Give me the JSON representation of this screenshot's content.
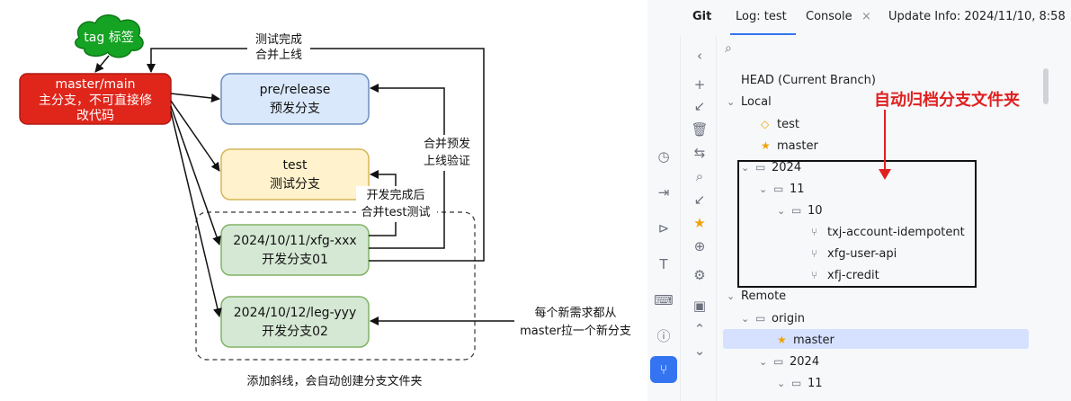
{
  "diagram": {
    "tag_cloud": "tag 标签",
    "master_box": [
      "master/main",
      "主分支，不可直接修",
      "改代码"
    ],
    "prerelease_box": [
      "pre/release",
      "预发分支"
    ],
    "test_box": [
      "test",
      "测试分支"
    ],
    "dev01_box": [
      "2024/10/11/xfg-xxx",
      "开发分支01"
    ],
    "dev02_box": [
      "2024/10/12/leg-yyy",
      "开发分支02"
    ],
    "note_test_done": [
      "测试完成",
      "合并上线"
    ],
    "note_merge_pre": [
      "合并预发",
      "上线验证"
    ],
    "note_dev_done": [
      "开发完成后",
      "合并test测试"
    ],
    "note_new_req": [
      "每个新需求都从",
      "master拉一个新分支"
    ],
    "note_slash": "添加斜线，会自动创建分支文件夹",
    "colors": {
      "master_fill": "#e0261b",
      "prerelease_fill": "#dae8fc",
      "test_fill": "#fff2cc",
      "dev_fill": "#d5e8d4",
      "cloud_fill": "#15a323"
    }
  },
  "ide": {
    "tabs": {
      "git": "Git",
      "log": "Log: test",
      "console": "Console",
      "console_close": "×",
      "update_info": "Update Info: 2024/11/10, 8:58"
    },
    "annotation": "自动归档分支文件夹",
    "tree": {
      "head": "HEAD (Current Branch)",
      "local": "Local",
      "test": "test",
      "master": "master",
      "y2024": "2024",
      "m11": "11",
      "d10": "10",
      "b1": "txj-account-idempotent",
      "b2": "xfg-user-api",
      "b3": "xfj-credit",
      "remote": "Remote",
      "origin": "origin",
      "r_master": "master",
      "r_2024": "2024",
      "r_11": "11"
    },
    "icons": {
      "search": "search-icon",
      "add": "plus-icon",
      "delete": "trash-icon",
      "fetch": "fetch-icon",
      "star": "star-icon",
      "chevron": "chevron-icon",
      "folder": "folder-icon",
      "branch": "branch-icon",
      "tag": "tag-icon"
    }
  }
}
